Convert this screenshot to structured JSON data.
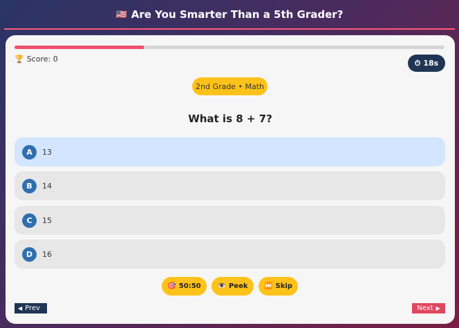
{
  "header": {
    "flag_icon": "us-flag-icon",
    "title": "Are You Smarter Than a 5th Grader?"
  },
  "progress": {
    "fraction": 0.3
  },
  "score": {
    "label": "Score: 0"
  },
  "timer": {
    "label": "18s"
  },
  "category": {
    "label": "2nd Grade • Math"
  },
  "question": {
    "text": "What is 8 + 7?"
  },
  "options": [
    {
      "letter": "A",
      "text": "13",
      "selected": true
    },
    {
      "letter": "B",
      "text": "14",
      "selected": false
    },
    {
      "letter": "C",
      "text": "15",
      "selected": false
    },
    {
      "letter": "D",
      "text": "16",
      "selected": false
    }
  ],
  "lifelines": [
    {
      "icon": "🎯",
      "label": "50:50"
    },
    {
      "icon": "👁️",
      "label": "Peek"
    },
    {
      "icon": "⏭️",
      "label": "Skip"
    }
  ],
  "nav": {
    "prev_label": "Prev",
    "next_label": "Next"
  },
  "colors": {
    "accent": "#ffc21a",
    "progress": "#f0506e",
    "dark": "#1f3553"
  }
}
